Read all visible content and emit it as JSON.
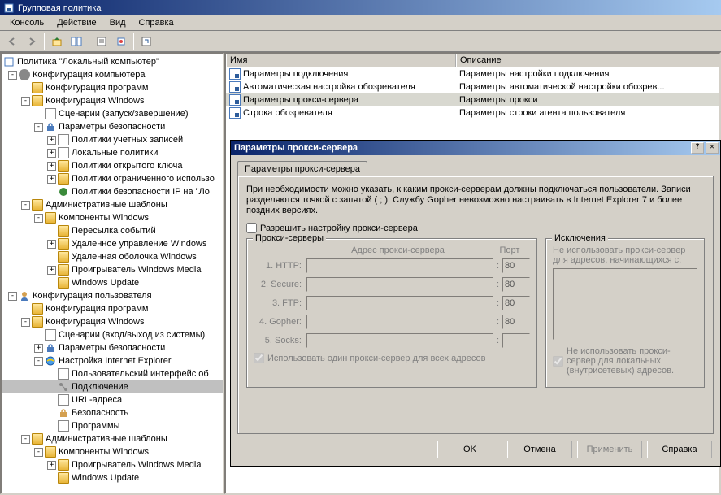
{
  "window": {
    "title": "Групповая политика"
  },
  "menu": {
    "console": "Консоль",
    "action": "Действие",
    "view": "Вид",
    "help": "Справка"
  },
  "tree": {
    "root": "Политика \"Локальный компьютер\"",
    "comp_config": "Конфигурация компьютера",
    "prog_config": "Конфигурация программ",
    "win_config": "Конфигурация Windows",
    "scenarios": "Сценарии (запуск/завершение)",
    "sec_params": "Параметры безопасности",
    "acct_policies": "Политики учетных записей",
    "local_policies": "Локальные политики",
    "pubkey_policies": "Политики открытого ключа",
    "restrict_policies": "Политики ограниченного использо",
    "ipsec_policies": "Политики безопасности IP на \"Ло",
    "admin_templates": "Административные шаблоны",
    "win_components": "Компоненты Windows",
    "event_fwd": "Пересылка событий",
    "remote_mgmt": "Удаленное управление Windows",
    "rm_shell": "Удаленная оболочка Windows",
    "wmp": "Проигрыватель Windows Media",
    "wupdate": "Windows Update",
    "user_config": "Конфигурация пользователя",
    "prog_config2": "Конфигурация программ",
    "win_config2": "Конфигурация Windows",
    "scenarios2": "Сценарии (вход/выход из системы)",
    "sec_params2": "Параметры безопасности",
    "ie_settings": "Настройка Internet Explorer",
    "user_iface": "Пользовательский интерфейс об",
    "connection": "Подключение",
    "url_addr": "URL-адреса",
    "security": "Безопасность",
    "programs": "Программы",
    "admin_templates2": "Административные шаблоны",
    "win_components2": "Компоненты Windows",
    "wmp2": "Проигрыватель Windows Media",
    "wupdate2": "Windows Update"
  },
  "list": {
    "hdr_name": "Имя",
    "hdr_desc": "Описание",
    "rows": [
      {
        "name": "Параметры подключения",
        "desc": "Параметры настройки подключения"
      },
      {
        "name": "Автоматическая настройка обозревателя",
        "desc": "Параметры автоматической настройки обозрев..."
      },
      {
        "name": "Параметры прокси-сервера",
        "desc": "Параметры прокси"
      },
      {
        "name": "Строка обозревателя",
        "desc": "Параметры строки агента пользователя"
      }
    ]
  },
  "dialog": {
    "title": "Параметры прокси-сервера",
    "tab": "Параметры прокси-сервера",
    "info": "При необходимости можно указать, к каким прокси-серверам должны подключаться пользователи. Записи разделяются точкой с запятой ( ; ). Службу Gopher невозможно настраивать в Internet Explorer 7 и более поздних версиях.",
    "chk_enable": "Разрешить настройку прокси-сервера",
    "group_proxy": "Прокси-серверы",
    "hdr_addr": "Адрес прокси-сервера",
    "hdr_port": "Порт",
    "lbl_http": "1. HTTP:",
    "lbl_secure": "2. Secure:",
    "lbl_ftp": "3. FTP:",
    "lbl_gopher": "4. Gopher:",
    "lbl_socks": "5. Socks:",
    "port_default": "80",
    "chk_same": "Использовать один прокси-сервер для всех адресов",
    "group_excl": "Исключения",
    "excl_text": "Не использовать прокси-сервер для адресов, начинающихся с:",
    "chk_local": "Не использовать прокси-сервер для локальных (внутрисетевых) адресов.",
    "btn_ok": "OK",
    "btn_cancel": "Отмена",
    "btn_apply": "Применить",
    "btn_help": "Справка"
  }
}
